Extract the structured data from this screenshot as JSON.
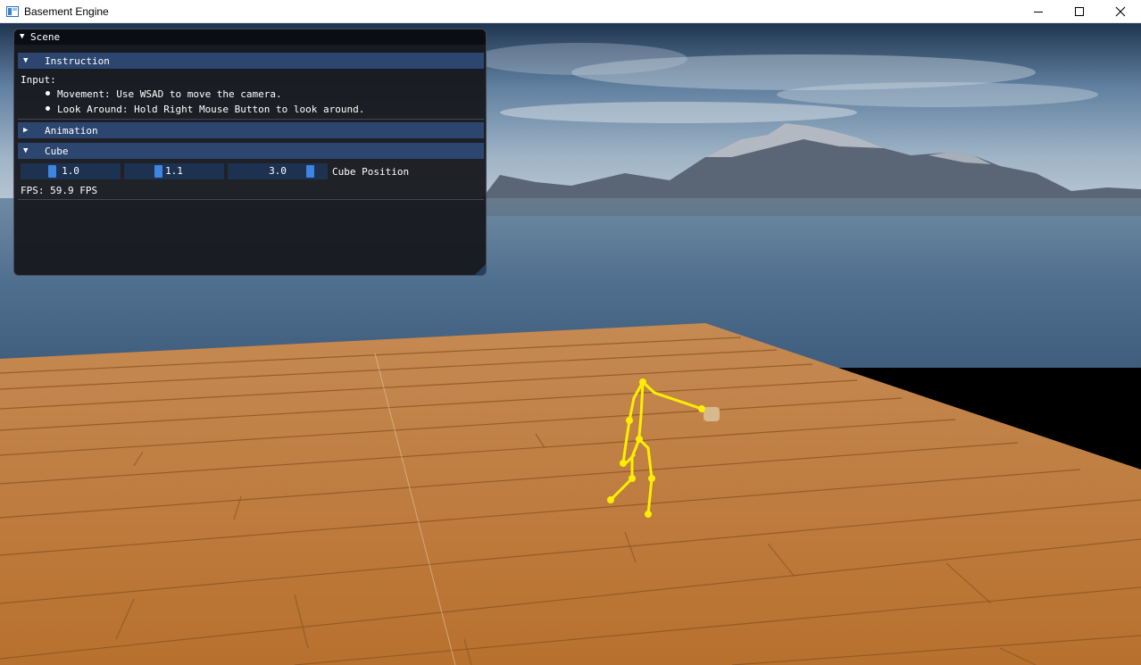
{
  "window": {
    "title": "Basement Engine",
    "controls": {
      "minimize_icon": "minimize-icon",
      "maximize_icon": "maximize-icon",
      "close_icon": "close-icon"
    }
  },
  "scene_panel": {
    "title": "Scene",
    "instruction": {
      "header": "Instruction",
      "input_label": "Input:",
      "bullets": [
        "Movement: Use WSAD to move the camera.",
        "Look Around: Hold Right Mouse Button to look around."
      ]
    },
    "animation": {
      "header": "Animation"
    },
    "cube": {
      "header": "Cube",
      "position_label": "Cube Position",
      "values": [
        "1.0",
        "1.1",
        "3.0"
      ]
    },
    "fps_text": "FPS: 59.9 FPS"
  },
  "colors": {
    "header_bg": "#2c4670",
    "slider_bg": "#1d3150",
    "slider_grab": "#3d85e0",
    "skeleton": "#ffee00",
    "floor": "#c07a35"
  }
}
